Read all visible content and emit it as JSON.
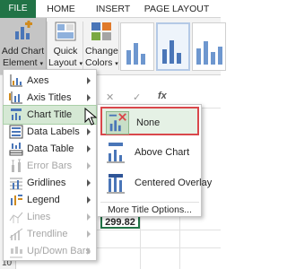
{
  "ribbon_tabs": {
    "file": "FILE",
    "home": "HOME",
    "insert": "INSERT",
    "page_layout": "PAGE LAYOUT"
  },
  "ribbon_buttons": {
    "add_chart_element": [
      "Add Chart",
      "Element"
    ],
    "quick_layout": [
      "Quick",
      "Layout"
    ],
    "change_colors": [
      "Change",
      "Colors"
    ]
  },
  "formula_bar": {
    "cancel": "✕",
    "enter": "✓",
    "fx": "fx"
  },
  "cell": {
    "value": "299.82"
  },
  "row_number": "10",
  "menu": {
    "items": [
      {
        "label": "Axes",
        "enabled": true,
        "highlighted": false
      },
      {
        "label": "Axis Titles",
        "enabled": true,
        "highlighted": false
      },
      {
        "label": "Chart Title",
        "enabled": true,
        "highlighted": true
      },
      {
        "label": "Data Labels",
        "enabled": true,
        "highlighted": false
      },
      {
        "label": "Data Table",
        "enabled": true,
        "highlighted": false
      },
      {
        "label": "Error Bars",
        "enabled": false,
        "highlighted": false
      },
      {
        "label": "Gridlines",
        "enabled": true,
        "highlighted": false
      },
      {
        "label": "Legend",
        "enabled": true,
        "highlighted": false
      },
      {
        "label": "Lines",
        "enabled": false,
        "highlighted": false
      },
      {
        "label": "Trendline",
        "enabled": false,
        "highlighted": false
      },
      {
        "label": "Up/Down Bars",
        "enabled": false,
        "highlighted": false
      }
    ]
  },
  "submenu": {
    "items": [
      {
        "label": "None",
        "icon": "no-title-icon",
        "selected": true
      },
      {
        "label": "Above Chart",
        "icon": "above-chart-title-icon",
        "selected": false
      },
      {
        "label": "Centered Overlay",
        "icon": "centered-overlay-title-icon",
        "selected": false
      }
    ],
    "more": "More Title Options..."
  },
  "colors": {
    "file_tab": "#217346",
    "highlight": "#d5e8d4",
    "selection_border": "#d9474b"
  }
}
